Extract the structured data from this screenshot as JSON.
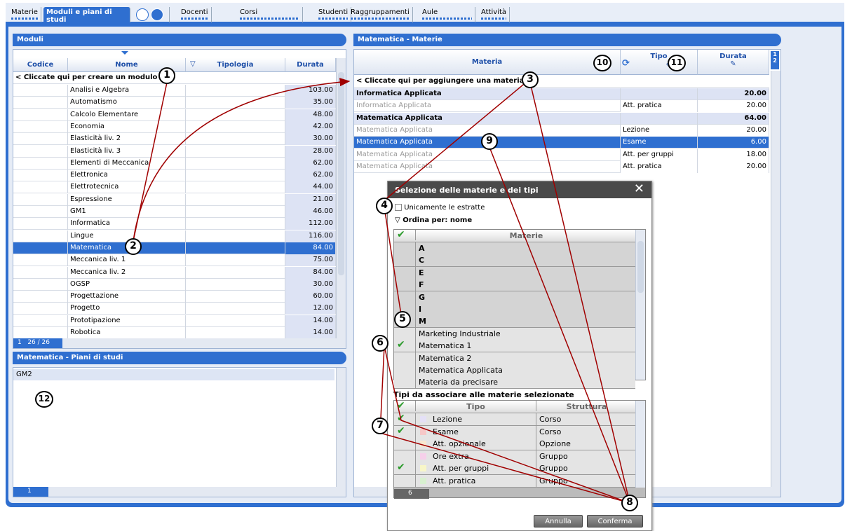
{
  "tabs": {
    "materie": "Materie",
    "moduli": "Moduli e piani di studi",
    "docenti": "Docenti",
    "corsi": "Corsi",
    "studenti": "Studenti",
    "raggruppamenti": "Raggruppamenti",
    "aule": "Aule",
    "attivita": "Attività"
  },
  "moduli": {
    "header": "Moduli",
    "columns": {
      "codice": "Codice",
      "nome": "Nome",
      "tipologia": "Tipologia",
      "durata": "Durata"
    },
    "create_row": "< Cliccate qui per creare un modulo >",
    "rows": [
      {
        "nome": "Analisi e Algebra",
        "durata": "103.00"
      },
      {
        "nome": "Automatismo",
        "durata": "35.00"
      },
      {
        "nome": "Calcolo Elementare",
        "durata": "48.00"
      },
      {
        "nome": "Economia",
        "durata": "42.00"
      },
      {
        "nome": "Elasticità liv. 2",
        "durata": "30.00"
      },
      {
        "nome": "Elasticità liv. 3",
        "durata": "28.00"
      },
      {
        "nome": "Elementi di Meccanica",
        "durata": "62.00"
      },
      {
        "nome": "Elettronica",
        "durata": "62.00"
      },
      {
        "nome": "Elettrotecnica",
        "durata": "44.00"
      },
      {
        "nome": "Espressione",
        "durata": "21.00"
      },
      {
        "nome": "GM1",
        "durata": "46.00"
      },
      {
        "nome": "Informatica",
        "durata": "112.00"
      },
      {
        "nome": "Lingue",
        "durata": "116.00"
      },
      {
        "nome": "Matematica",
        "durata": "84.00"
      },
      {
        "nome": "Meccanica liv. 1",
        "durata": "75.00"
      },
      {
        "nome": "Meccanica liv. 2",
        "durata": "84.00"
      },
      {
        "nome": "OGSP",
        "durata": "30.00"
      },
      {
        "nome": "Progettazione",
        "durata": "60.00"
      },
      {
        "nome": "Progetto",
        "durata": "12.00"
      },
      {
        "nome": "Prototipazione",
        "durata": "14.00"
      },
      {
        "nome": "Robotica",
        "durata": "14.00"
      }
    ],
    "footer_page": "1",
    "footer_count": "26 / 26"
  },
  "piani": {
    "header": "Matematica - Piani di studi",
    "row": "GM2",
    "footer_page": "1"
  },
  "materie": {
    "header": "Matematica - Materie",
    "columns": {
      "materia": "Materia",
      "tipo": "Tipo",
      "durata": "Durata"
    },
    "page_tabs": [
      "1",
      "2"
    ],
    "add_row": "< Cliccate qui per aggiungere una materia >",
    "rows": [
      {
        "materia": "Informatica Applicata",
        "tipo": "",
        "durata": "20.00",
        "group": true
      },
      {
        "materia": "Informatica Applicata",
        "tipo": "Att. pratica",
        "durata": "20.00",
        "group": false
      },
      {
        "materia": "Matematica Applicata",
        "tipo": "",
        "durata": "64.00",
        "group": true
      },
      {
        "materia": "Matematica Applicata",
        "tipo": "Lezione",
        "durata": "20.00",
        "group": false
      },
      {
        "materia": "Matematica Applicata",
        "tipo": "Esame",
        "durata": "6.00",
        "group": false,
        "selected": true
      },
      {
        "materia": "Matematica Applicata",
        "tipo": "Att. per gruppi",
        "durata": "18.00",
        "group": false
      },
      {
        "materia": "Matematica Applicata",
        "tipo": "Att. pratica",
        "durata": "20.00",
        "group": false
      }
    ]
  },
  "dialog": {
    "title": "Selezione delle materie e dei tipi",
    "only_extracted": "Unicamente le estratte",
    "sort_by": "Ordina per: nome",
    "materie_col": "Materie",
    "materie_rows": [
      {
        "label": "A",
        "group": true,
        "checked": false
      },
      {
        "label": "C",
        "group": true,
        "checked": false
      },
      {
        "label": "E",
        "group": true,
        "checked": false
      },
      {
        "label": "F",
        "group": true,
        "checked": false
      },
      {
        "label": "G",
        "group": true,
        "checked": false
      },
      {
        "label": "I",
        "group": true,
        "checked": false
      },
      {
        "label": "M",
        "group": true,
        "checked": false
      },
      {
        "label": "Marketing Industriale",
        "group": false,
        "checked": false
      },
      {
        "label": "Matematica 1",
        "group": false,
        "checked": true
      },
      {
        "label": "Matematica 2",
        "group": false,
        "checked": false
      },
      {
        "label": "Matematica Applicata",
        "group": false,
        "checked": false
      },
      {
        "label": "Materia da precisare",
        "group": false,
        "checked": false
      }
    ],
    "types_title": "Tipi da associare alle materie selezionate",
    "types_cols": {
      "tipo": "Tipo",
      "struttura": "Struttura"
    },
    "types": [
      {
        "tipo": "Lezione",
        "struttura": "Corso",
        "checked": true,
        "color": "#e4e0f6"
      },
      {
        "tipo": "Esame",
        "struttura": "Corso",
        "checked": true,
        "color": "#f6c8c8"
      },
      {
        "tipo": "Att. opzionale",
        "struttura": "Opzione",
        "checked": false,
        "color": "#f8e8d0"
      },
      {
        "tipo": "Ore extra",
        "struttura": "Gruppo",
        "checked": false,
        "color": "#f6d0ea"
      },
      {
        "tipo": "Att. per gruppi",
        "struttura": "Gruppo",
        "checked": true,
        "color": "#f8f6c8"
      },
      {
        "tipo": "Att. pratica",
        "struttura": "Gruppo",
        "checked": false,
        "color": "#d8f0d0"
      }
    ],
    "types_count": "6",
    "cancel": "Annulla",
    "confirm": "Conferma"
  },
  "callouts": [
    "1",
    "2",
    "3",
    "4",
    "5",
    "6",
    "7",
    "8",
    "9",
    "10",
    "11",
    "12"
  ]
}
